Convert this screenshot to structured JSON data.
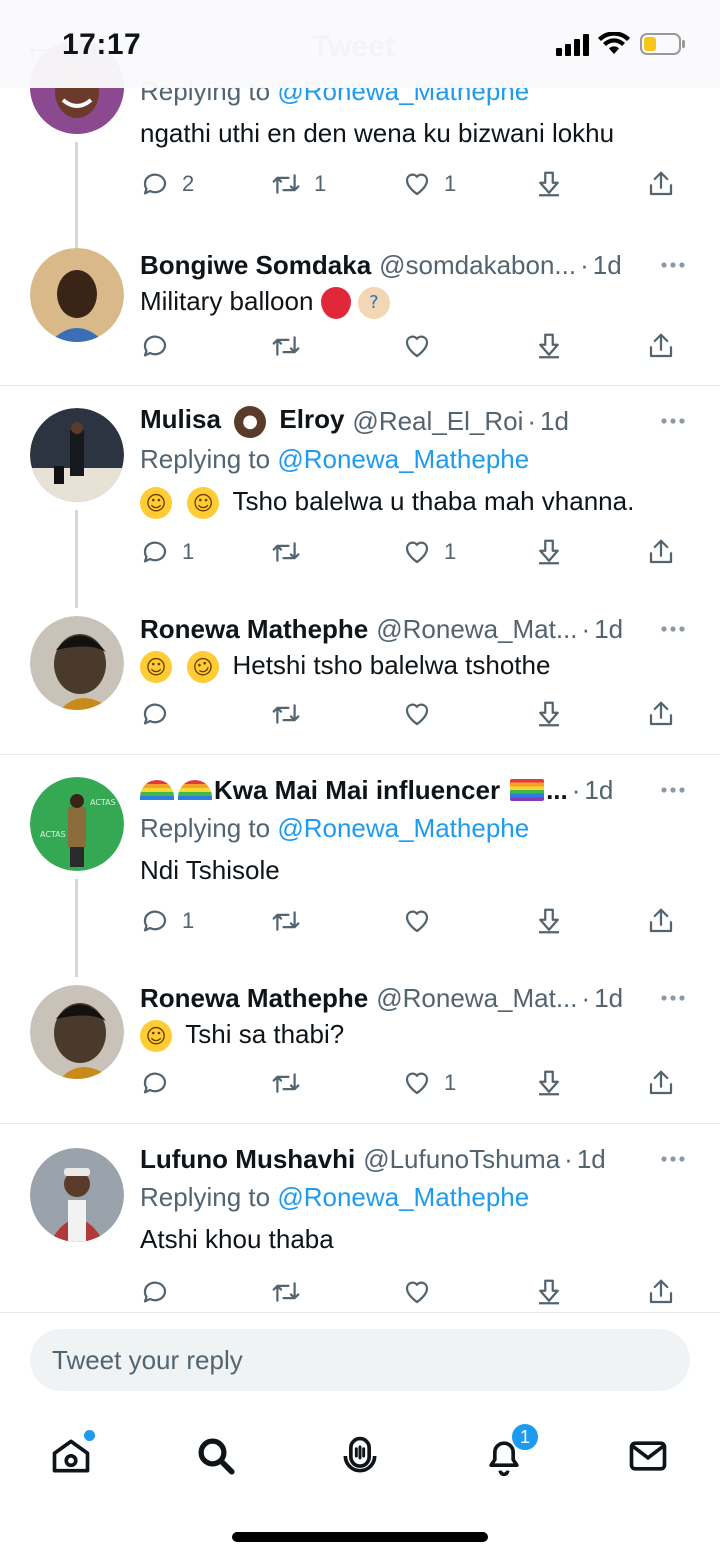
{
  "status_bar": {
    "time": "17:17",
    "ghost_title": "Tweet",
    "battery_color": "#f5c518"
  },
  "tweets": [
    {
      "name": "",
      "handle": "",
      "time": "",
      "replying_prefix": "Replying to ",
      "replying_to": "@Ronewa_Mathephe",
      "text": "ngathi uthi en den wena ku bizwani lokhu",
      "reply_count": "2",
      "retweet_count": "1",
      "like_count": "1",
      "avatar_color": "#8b4a8f"
    },
    {
      "name": "Bongiwe Somdaka",
      "handle": "@somdakabon...",
      "time": "1d",
      "text": "Military balloon",
      "reply_count": "",
      "retweet_count": "",
      "like_count": "",
      "avatar_color": "#d9b98a"
    },
    {
      "name_part1": "Mulisa",
      "name_part2": "Elroy",
      "handle": "@Real_El_Roi",
      "time": "1d",
      "replying_prefix": "Replying to ",
      "replying_to": "@Ronewa_Mathephe",
      "text": "Tsho balelwa u thaba mah vhanna.",
      "reply_count": "1",
      "retweet_count": "",
      "like_count": "1",
      "avatar_color": "#2b3440"
    },
    {
      "name": "Ronewa Mathephe",
      "handle": "@Ronewa_Mat...",
      "time": "1d",
      "text": "Hetshi tsho balelwa tshothe",
      "reply_count": "",
      "retweet_count": "",
      "like_count": "",
      "avatar_color": "#4a3a2c"
    },
    {
      "name": "Kwa Mai Mai influencer",
      "name_suffix": "...",
      "time": "1d",
      "replying_prefix": "Replying to ",
      "replying_to": "@Ronewa_Mathephe",
      "text": "Ndi Tshisole",
      "reply_count": "1",
      "retweet_count": "",
      "like_count": "",
      "avatar_color": "#34a853"
    },
    {
      "name": "Ronewa Mathephe",
      "handle": "@Ronewa_Mat...",
      "time": "1d",
      "text": "Tshi sa thabi?",
      "reply_count": "",
      "retweet_count": "",
      "like_count": "1",
      "avatar_color": "#4a3a2c"
    },
    {
      "name": "Lufuno Mushavhi",
      "handle": "@LufunoTshuma",
      "time": "1d",
      "replying_prefix": "Replying to ",
      "replying_to": "@Ronewa_Mathephe",
      "text": "Atshi khou thaba",
      "reply_count": "",
      "retweet_count": "",
      "like_count": "",
      "avatar_color": "#b03a3a"
    }
  ],
  "reply_box": {
    "placeholder": "Tweet your reply"
  },
  "tab_bar": {
    "notification_count": "1",
    "accent": "#1d9bf0"
  }
}
